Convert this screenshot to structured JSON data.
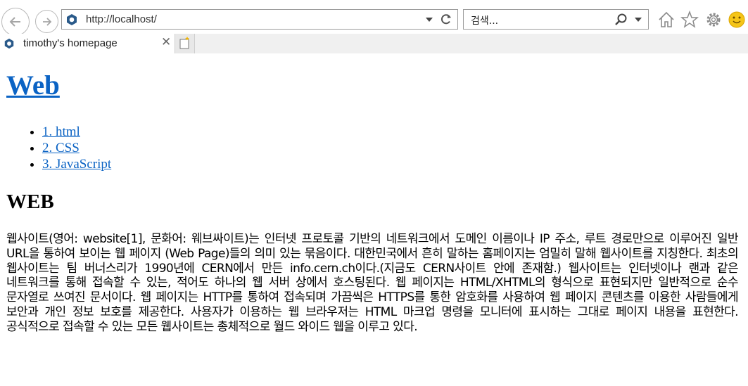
{
  "browser": {
    "address": {
      "url": "http://localhost/"
    },
    "search": {
      "placeholder": "검색..."
    },
    "tab": {
      "title": "timothy's homepage",
      "close_glyph": "✕"
    },
    "icons": [
      "back-arrow-icon",
      "forward-arrow-icon",
      "site-favicon-icon",
      "dropdown-arrow-icon",
      "refresh-icon",
      "search-icon",
      "home-icon",
      "star-icon",
      "gear-icon",
      "smiley-icon",
      "new-tab-icon"
    ]
  },
  "page": {
    "title": "Web",
    "toc": [
      {
        "label": "1. html"
      },
      {
        "label": "2. CSS"
      },
      {
        "label": "3. JavaScript"
      }
    ],
    "heading": "WEB",
    "body": "웹사이트(영어: website[1], 문화어: 웨브싸이트)는 인터넷 프로토콜 기반의 네트워크에서 도메인 이름이나 IP 주소, 루트 경로만으로 이루어진 일반 URL을 통하여 보이는 웹 페이지 (Web Page)들의 의미 있는 묶음이다. 대한민국에서 흔히 말하는 홈페이지는 엄밀히 말해 웹사이트를 지칭한다. 최초의 웹사이트는 팀 버너스리가 1990년에 CERN에서 만든 info.cern.ch이다.(지금도 CERN사이트 안에 존재함.) 웹사이트는 인터넷이나 랜과 같은 네트워크를 통해 접속할 수 있는, 적어도 하나의 웹 서버 상에서 호스팅된다. 웹 페이지는 HTML/XHTML의 형식으로 표현되지만 일반적으로 순수 문자열로 쓰여진 문서이다. 웹 페이지는 HTTP를 통하여 접속되며 가끔씩은 HTTPS를 통한 암호화를 사용하여 웹 페이지 콘텐츠를 이용한 사람들에게 보안과 개인 정보 보호를 제공한다. 사용자가 이용하는 웹 브라우저는 HTML 마크업 명령을 모니터에 표시하는 그대로 페이지 내용을 표현한다. 공식적으로 접속할 수 있는 모든 웹사이트는 총체적으로 월드 와이드 웹을 이루고 있다."
  },
  "colors": {
    "link": "#0b63c4",
    "favicon": "#2a5a8a",
    "smiley": "#f5c518"
  }
}
